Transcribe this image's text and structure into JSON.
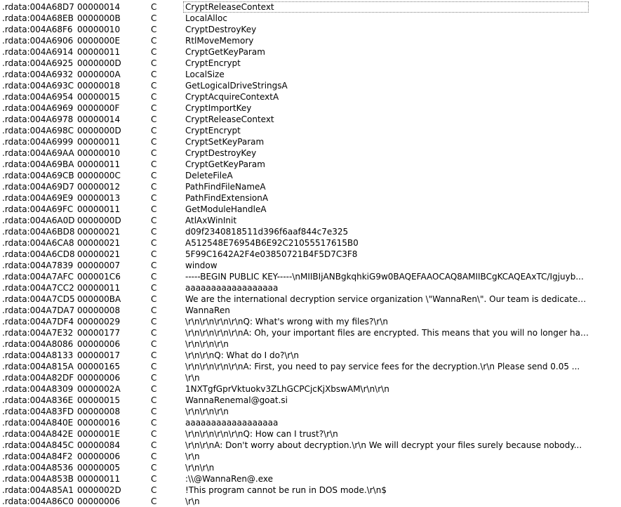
{
  "strings": [
    {
      "address": ".rdata:004A68D7",
      "length": "00000014",
      "type": "C",
      "string": "CryptReleaseContext"
    },
    {
      "address": ".rdata:004A68EB",
      "length": "0000000B",
      "type": "C",
      "string": "LocalAlloc"
    },
    {
      "address": ".rdata:004A68F6",
      "length": "00000010",
      "type": "C",
      "string": "CryptDestroyKey"
    },
    {
      "address": ".rdata:004A6906",
      "length": "0000000E",
      "type": "C",
      "string": "RtlMoveMemory"
    },
    {
      "address": ".rdata:004A6914",
      "length": "00000011",
      "type": "C",
      "string": "CryptGetKeyParam"
    },
    {
      "address": ".rdata:004A6925",
      "length": "0000000D",
      "type": "C",
      "string": "CryptEncrypt"
    },
    {
      "address": ".rdata:004A6932",
      "length": "0000000A",
      "type": "C",
      "string": "LocalSize"
    },
    {
      "address": ".rdata:004A693C",
      "length": "00000018",
      "type": "C",
      "string": "GetLogicalDriveStringsA"
    },
    {
      "address": ".rdata:004A6954",
      "length": "00000015",
      "type": "C",
      "string": "CryptAcquireContextA"
    },
    {
      "address": ".rdata:004A6969",
      "length": "0000000F",
      "type": "C",
      "string": "CryptImportKey"
    },
    {
      "address": ".rdata:004A6978",
      "length": "00000014",
      "type": "C",
      "string": "CryptReleaseContext"
    },
    {
      "address": ".rdata:004A698C",
      "length": "0000000D",
      "type": "C",
      "string": "CryptEncrypt"
    },
    {
      "address": ".rdata:004A6999",
      "length": "00000011",
      "type": "C",
      "string": "CryptSetKeyParam"
    },
    {
      "address": ".rdata:004A69AA",
      "length": "00000010",
      "type": "C",
      "string": "CryptDestroyKey"
    },
    {
      "address": ".rdata:004A69BA",
      "length": "00000011",
      "type": "C",
      "string": "CryptGetKeyParam"
    },
    {
      "address": ".rdata:004A69CB",
      "length": "0000000C",
      "type": "C",
      "string": "DeleteFileA"
    },
    {
      "address": ".rdata:004A69D7",
      "length": "00000012",
      "type": "C",
      "string": "PathFindFileNameA"
    },
    {
      "address": ".rdata:004A69E9",
      "length": "00000013",
      "type": "C",
      "string": "PathFindExtensionA"
    },
    {
      "address": ".rdata:004A69FC",
      "length": "00000011",
      "type": "C",
      "string": "GetModuleHandleA"
    },
    {
      "address": ".rdata:004A6A0D",
      "length": "0000000D",
      "type": "C",
      "string": "AtlAxWinInit"
    },
    {
      "address": ".rdata:004A6BD8",
      "length": "00000021",
      "type": "C",
      "string": "d09f2340818511d396f6aaf844c7e325"
    },
    {
      "address": ".rdata:004A6CA8",
      "length": "00000021",
      "type": "C",
      "string": "A512548E76954B6E92C21055517615B0"
    },
    {
      "address": ".rdata:004A6CD8",
      "length": "00000021",
      "type": "C",
      "string": "5F99C1642A2F4e03850721B4F5D7C3F8"
    },
    {
      "address": ".rdata:004A7839",
      "length": "00000007",
      "type": "C",
      "string": "window"
    },
    {
      "address": ".rdata:004A7AFC",
      "length": "000001C6",
      "type": "C",
      "string": "-----BEGIN PUBLIC KEY-----\\nMIIBIjANBgkqhkiG9w0BAQEFAAOCAQ8AMIIBCgKCAQEAxTC/Igjuyb..."
    },
    {
      "address": ".rdata:004A7CC2",
      "length": "00000011",
      "type": "C",
      "string": "aaaaaaaaaaaaaaaaaa"
    },
    {
      "address": ".rdata:004A7CD5",
      "length": "000000BA",
      "type": "C",
      "string": "We are the international decryption service organization \\\"WannaRen\\\". Our team is dedicated t..."
    },
    {
      "address": ".rdata:004A7DA7",
      "length": "00000008",
      "type": "C",
      "string": "WannaRen"
    },
    {
      "address": ".rdata:004A7DF4",
      "length": "00000029",
      "type": "C",
      "string": "\\r\\n\\r\\n\\r\\n\\r\\nQ:  What's wrong with my files?\\r\\n"
    },
    {
      "address": ".rdata:004A7E32",
      "length": "00000177",
      "type": "C",
      "string": "\\r\\n\\r\\n\\r\\n\\r\\nA: Oh, your important files are encrypted. This means that you will no longer have ac..."
    },
    {
      "address": ".rdata:004A8086",
      "length": "00000006",
      "type": "C",
      "string": "\\r\\n\\r\\n\\r\\n"
    },
    {
      "address": ".rdata:004A8133",
      "length": "00000017",
      "type": "C",
      "string": "\\r\\n\\r\\nQ:  What do I do?\\r\\n"
    },
    {
      "address": ".rdata:004A815A",
      "length": "00000165",
      "type": "C",
      "string": "\\r\\n\\r\\n\\r\\n\\r\\nA:  First, you need to pay service fees for the decryption.\\r\\n    Please send 0.05 ..."
    },
    {
      "address": ".rdata:004A82DF",
      "length": "00000006",
      "type": "C",
      "string": "\\r\\n"
    },
    {
      "address": ".rdata:004A8309",
      "length": "0000002A",
      "type": "C",
      "string": "1NXTgfGprVktuokv3ZLhGCPCjcKjXbswAM\\r\\n\\r\\n"
    },
    {
      "address": ".rdata:004A836E",
      "length": "00000015",
      "type": "C",
      "string": "WannaRenemal@goat.si"
    },
    {
      "address": ".rdata:004A83FD",
      "length": "00000008",
      "type": "C",
      "string": "\\r\\n\\r\\n\\r\\n"
    },
    {
      "address": ".rdata:004A840E",
      "length": "00000016",
      "type": "C",
      "string": "aaaaaaaaaaaaaaaaaa"
    },
    {
      "address": ".rdata:004A842E",
      "length": "0000001E",
      "type": "C",
      "string": "\\r\\n\\r\\n\\r\\n\\r\\nQ:  How can I trust?\\r\\n"
    },
    {
      "address": ".rdata:004A845C",
      "length": "00000084",
      "type": "C",
      "string": "\\r\\n\\r\\nA:  Don't worry about decryption.\\r\\n    We will decrypt your files surely because nobody..."
    },
    {
      "address": ".rdata:004A84F2",
      "length": "00000006",
      "type": "C",
      "string": "\\r\\n"
    },
    {
      "address": ".rdata:004A8536",
      "length": "00000005",
      "type": "C",
      "string": "\\r\\n\\r\\n"
    },
    {
      "address": ".rdata:004A853B",
      "length": "00000011",
      "type": "C",
      "string": ":\\\\@WannaRen@.exe"
    },
    {
      "address": ".rdata:004A85A1",
      "length": "0000002D",
      "type": "C",
      "string": "!This program cannot be run in DOS mode.\\r\\n$"
    }
  ],
  "partial_row": {
    "address": ".rdata:004A86C0",
    "length": "00000006",
    "type": "C",
    "string": "\\r\\n"
  },
  "colors": {
    "background": "#ffffff",
    "text": "#000000",
    "selection_outline": "#7a7a7a"
  }
}
